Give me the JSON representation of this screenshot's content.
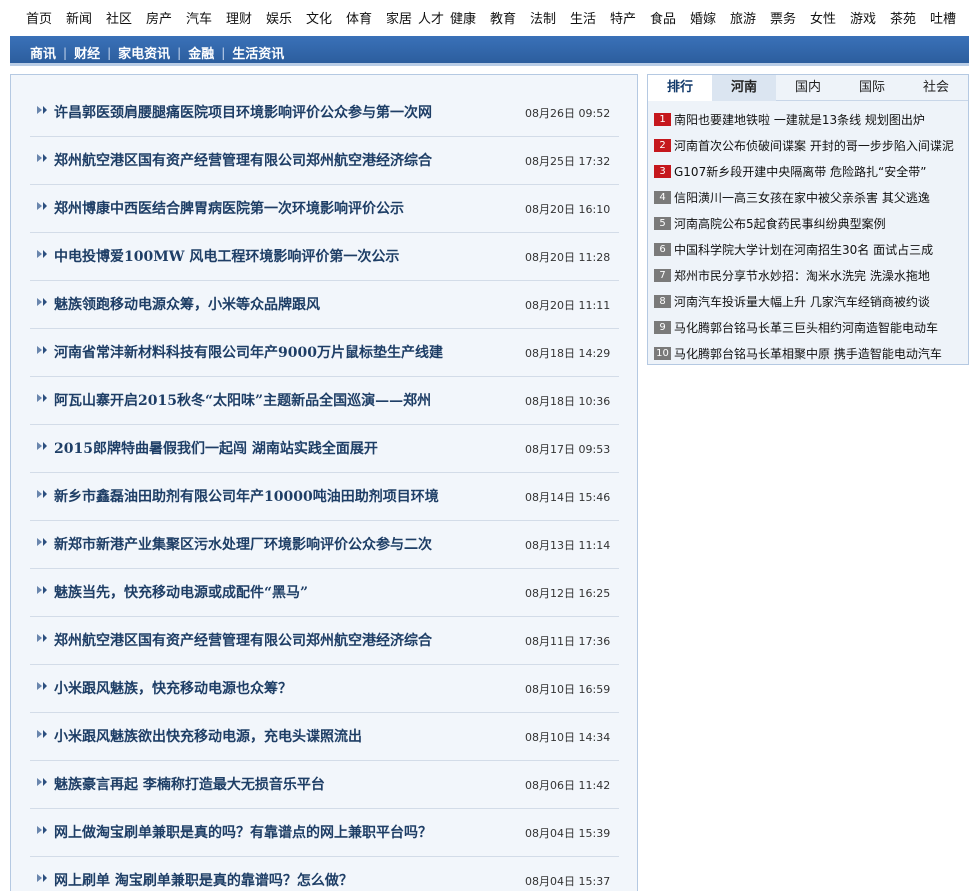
{
  "top_nav": [
    "首页",
    "新闻",
    "社区",
    "房产",
    "汽车",
    "理财",
    "娱乐",
    "文化",
    "体育",
    "家居",
    "人才",
    "健康",
    "教育",
    "法制",
    "生活",
    "特产",
    "食品",
    "婚嫁",
    "旅游",
    "票务",
    "女性",
    "游戏",
    "茶苑",
    "吐槽"
  ],
  "sub_nav": [
    "商讯",
    "财经",
    "家电资讯",
    "金融",
    "生活资讯"
  ],
  "sub_nav_sep": "|",
  "news": [
    {
      "title": "许昌郭医颈肩腰腿痛医院项目环境影响评价公众参与第一次网",
      "date": "08月26日 09:52"
    },
    {
      "title": "郑州航空港区国有资产经营管理有限公司郑州航空港经济综合",
      "date": "08月25日 17:32"
    },
    {
      "title": "郑州博康中西医结合脾胃病医院第一次环境影响评价公示",
      "date": "08月20日 16:10"
    },
    {
      "title": "中电投博爱100MW 风电工程环境影响评价第一次公示",
      "date": "08月20日 11:28"
    },
    {
      "title": "魅族领跑移动电源众筹，小米等众品牌跟风",
      "date": "08月20日 11:11"
    },
    {
      "title": "河南省常沣新材料科技有限公司年产9000万片鼠标垫生产线建",
      "date": "08月18日 14:29"
    },
    {
      "title": "阿瓦山寨开启2015秋冬“太阳味”主题新品全国巡演——郑州",
      "date": "08月18日 10:36"
    },
    {
      "title": "2015郎牌特曲暑假我们一起闯 湖南站实践全面展开",
      "date": "08月17日 09:53"
    },
    {
      "title": "新乡市鑫磊油田助剂有限公司年产10000吨油田助剂项目环境",
      "date": "08月14日 15:46"
    },
    {
      "title": "新郑市新港产业集聚区污水处理厂环境影响评价公众参与二次",
      "date": "08月13日 11:14"
    },
    {
      "title": "魅族当先，快充移动电源或成配件“黑马”",
      "date": "08月12日 16:25"
    },
    {
      "title": "郑州航空港区国有资产经营管理有限公司郑州航空港经济综合",
      "date": "08月11日 17:36"
    },
    {
      "title": "小米跟风魅族，快充移动电源也众筹？",
      "date": "08月10日 16:59"
    },
    {
      "title": "小米跟风魅族欲出快充移动电源，充电头谍照流出",
      "date": "08月10日 14:34"
    },
    {
      "title": "魅族豪言再起 李楠称打造最大无损音乐平台",
      "date": "08月06日 11:42"
    },
    {
      "title": "网上做淘宝刷单兼职是真的吗？有靠谱点的网上兼职平台吗？",
      "date": "08月04日 15:39"
    },
    {
      "title": "网上刷单 淘宝刷单兼职是真的靠谱吗？怎么做？",
      "date": "08月04日 15:37"
    }
  ],
  "rank_tabs": [
    "排行",
    "河南",
    "国内",
    "国际",
    "社会"
  ],
  "rank_items": [
    {
      "num": "1",
      "text": "南阳也要建地铁啦 一建就是13条线 规划图出炉"
    },
    {
      "num": "2",
      "text": "河南首次公布侦破间谍案 开封的哥一步步陷入间谍泥"
    },
    {
      "num": "3",
      "text": "G107新乡段开建中央隔离带 危险路扎“安全带”"
    },
    {
      "num": "4",
      "text": "信阳潢川一高三女孩在家中被父亲杀害 其父逃逸"
    },
    {
      "num": "5",
      "text": "河南高院公布5起食药民事纠纷典型案例"
    },
    {
      "num": "6",
      "text": "中国科学院大学计划在河南招生30名 面试占三成"
    },
    {
      "num": "7",
      "text": "郑州市民分享节水妙招：淘米水洗完 洗澡水拖地"
    },
    {
      "num": "8",
      "text": "河南汽车投诉量大幅上升 几家汽车经销商被约谈"
    },
    {
      "num": "9",
      "text": "马化腾郭台铭马长革三巨头相约河南造智能电动车"
    },
    {
      "num": "10",
      "text": "马化腾郭台铭马长革相聚中原 携手造智能电动汽车"
    }
  ],
  "colors": {
    "accent": "#2c5e9e",
    "hot_rank": "#c5171d",
    "rank_gray": "#7a7a7a",
    "title_blue": "#1e3e66"
  }
}
